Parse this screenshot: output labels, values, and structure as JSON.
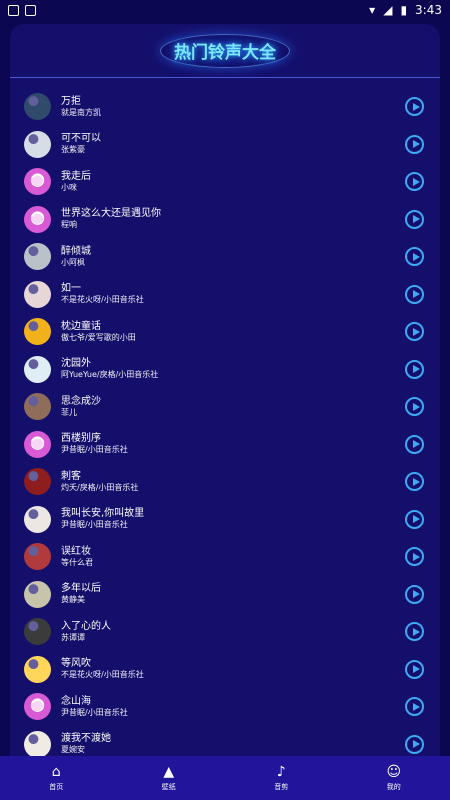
{
  "status_bar": {
    "time": "3:43",
    "left_icons": [
      "photo-icon",
      "font-icon"
    ],
    "right_icons": [
      "wifi-icon",
      "signal-icon",
      "battery-icon"
    ]
  },
  "page_title": "热门铃声大全",
  "songs": [
    {
      "title": "万拒",
      "artist": "就是南方凯",
      "avatar_color": "#304a6b"
    },
    {
      "title": "可不可以",
      "artist": "张紫豪",
      "avatar_color": "#d7dde6"
    },
    {
      "title": "我走后",
      "artist": "小咪",
      "avatar_color": "#d85ad4"
    },
    {
      "title": "世界这么大还是遇见你",
      "artist": "程响",
      "avatar_color": "#d85ad4"
    },
    {
      "title": "醉倾城",
      "artist": "小阿枫",
      "avatar_color": "#b9c2c9"
    },
    {
      "title": "如一",
      "artist": "不是花火呀/小田音乐社",
      "avatar_color": "#e6d6d8"
    },
    {
      "title": "枕边童话",
      "artist": "傲七爷/爱写歌的小田",
      "avatar_color": "#f0b11a"
    },
    {
      "title": "沈园外",
      "artist": "阿YueYue/戾格/小田音乐社",
      "avatar_color": "#dfeef5"
    },
    {
      "title": "思念成沙",
      "artist": "菲儿",
      "avatar_color": "#8f6d5a"
    },
    {
      "title": "西楼别序",
      "artist": "尹昔眠/小田音乐社",
      "avatar_color": "#d85ad4"
    },
    {
      "title": "刺客",
      "artist": "灼夭/戾格/小田音乐社",
      "avatar_color": "#8d1d1f"
    },
    {
      "title": "我叫长安,你叫故里",
      "artist": "尹昔眠/小田音乐社",
      "avatar_color": "#ece7e3"
    },
    {
      "title": "误红妆",
      "artist": "等什么君",
      "avatar_color": "#b13a3c"
    },
    {
      "title": "多年以后",
      "artist": "黄静美",
      "avatar_color": "#c8c4ab"
    },
    {
      "title": "入了心的人",
      "artist": "苏谭谭",
      "avatar_color": "#3b3b3b"
    },
    {
      "title": "等风吹",
      "artist": "不是花火呀/小田音乐社",
      "avatar_color": "#ffd55a"
    },
    {
      "title": "念山海",
      "artist": "尹昔眠/小田音乐社",
      "avatar_color": "#d85ad4"
    },
    {
      "title": "渡我不渡她",
      "artist": "夏婉安",
      "avatar_color": "#f1ece3"
    }
  ],
  "nav": [
    {
      "label": "首页",
      "icon": "home-icon"
    },
    {
      "label": "壁纸",
      "icon": "wallpaper-icon"
    },
    {
      "label": "音剪",
      "icon": "music-note-icon"
    },
    {
      "label": "我的",
      "icon": "profile-icon"
    }
  ],
  "colors": {
    "background": "#0b0750",
    "panel": "#140f6a",
    "accent": "#3fa9f5",
    "nav_bar": "#20159b",
    "title": "#7ce6ff"
  }
}
